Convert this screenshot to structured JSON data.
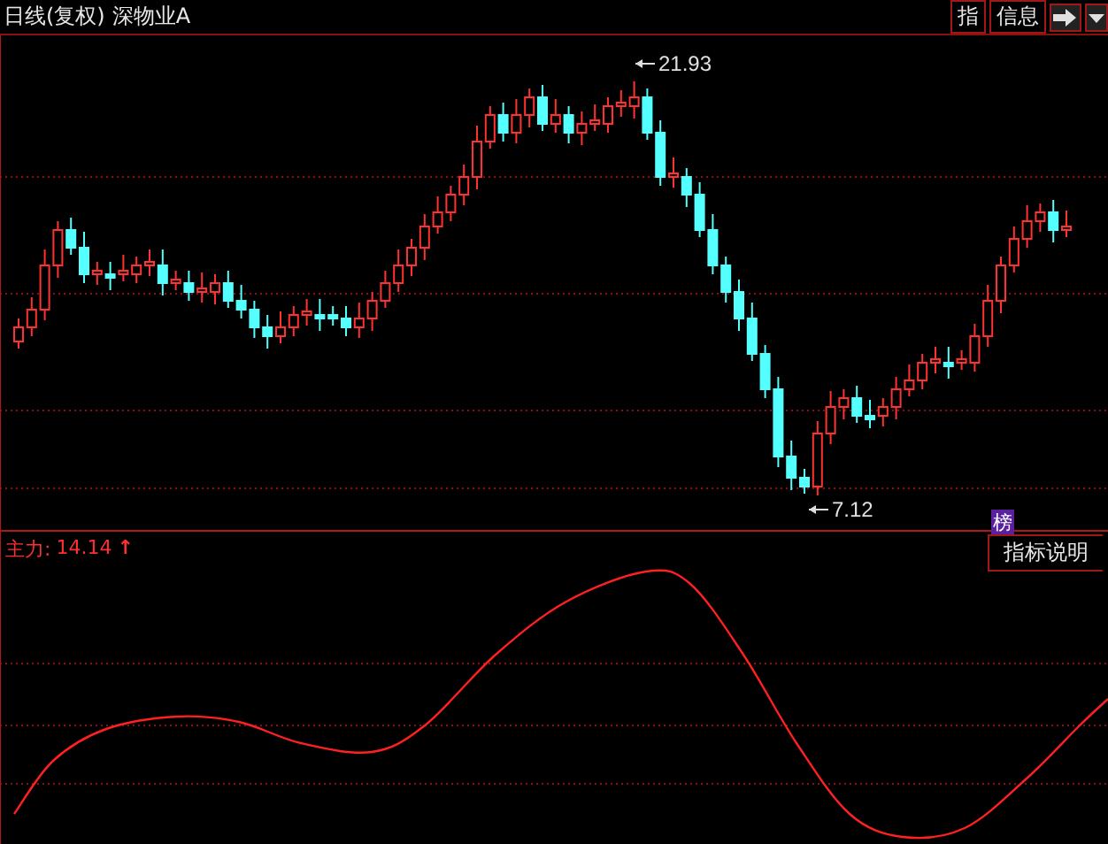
{
  "toolbar": {
    "period": "日线(复权)",
    "security": "深物业A",
    "buttons": [
      "指",
      "信息"
    ]
  },
  "price_chart": {
    "high_label": "21.93",
    "low_label": "7.12"
  },
  "indicator": {
    "name": "主力:",
    "value": "14.14",
    "arrow": "↑",
    "badge": "榜",
    "help_button": "指标说明"
  }
}
